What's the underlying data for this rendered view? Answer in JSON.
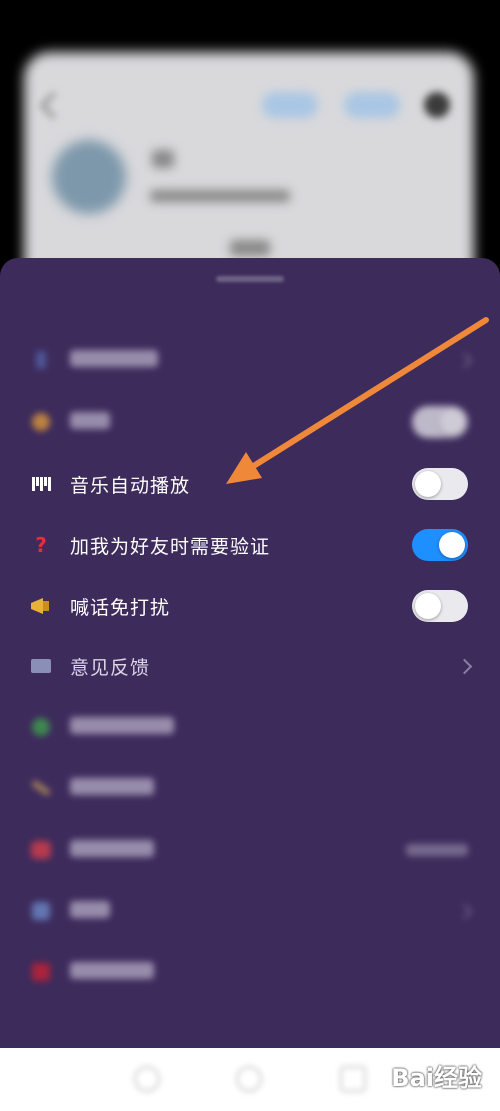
{
  "sheet": {
    "items": [
      {
        "label": "",
        "control": "chevron",
        "icon": "user-icon"
      },
      {
        "label": "",
        "control": "toggle",
        "toggle_on": true,
        "icon": "shake-icon"
      },
      {
        "label": "音乐自动播放",
        "control": "toggle",
        "toggle_on": false,
        "icon": "piano-icon"
      },
      {
        "label": "加我为好友时需要验证",
        "control": "toggle",
        "toggle_on": true,
        "icon": "question-icon"
      },
      {
        "label": "喊话免打扰",
        "control": "toggle",
        "toggle_on": false,
        "icon": "megaphone-icon"
      },
      {
        "label": "意见反馈",
        "control": "chevron",
        "icon": "feedback-icon"
      },
      {
        "label": "",
        "control": "none",
        "icon": "clover-icon"
      },
      {
        "label": "",
        "control": "none",
        "icon": "pen-icon"
      },
      {
        "label": "",
        "control": "value",
        "icon": "heart-icon"
      },
      {
        "label": "",
        "control": "chevron",
        "icon": "info-icon"
      },
      {
        "label": "",
        "control": "none",
        "icon": "logout-icon"
      }
    ]
  },
  "annotation": {
    "arrow_color": "#f0883a"
  },
  "colors": {
    "sheet": "#3d2b5c",
    "toggle_on": "#1e8fff",
    "toggle_off": "#e9e9ee"
  },
  "watermark": "Bai经验"
}
